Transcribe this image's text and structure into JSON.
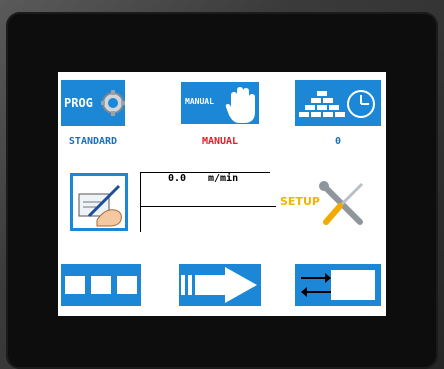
{
  "top_row": {
    "prog": {
      "label": "PROG",
      "caption": "STANDARD",
      "caption_color": "#1b6fb8"
    },
    "manual": {
      "label": "MANUAL",
      "caption": "MANUAL",
      "caption_color": "#e0202a"
    },
    "count": {
      "caption": "0",
      "caption_color": "#1b6fb8"
    }
  },
  "middle": {
    "speed_value": "0.0",
    "speed_unit": "m/min",
    "setup_label": "SETUP"
  },
  "colors": {
    "accent": "#1b87d6",
    "setup_text": "#f2b400"
  },
  "icons": [
    "gear-icon",
    "hand-icon",
    "bricks-clock-icon",
    "hand-writing-icon",
    "wrench-screwdriver-icon",
    "three-blocks-icon",
    "arrow-right-icon",
    "transfer-arrows-icon"
  ]
}
